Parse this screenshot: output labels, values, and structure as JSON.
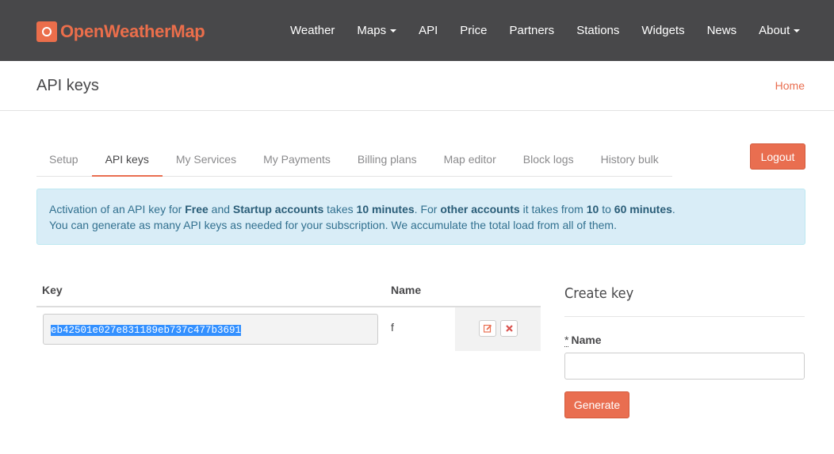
{
  "brand": {
    "name": "OpenWeatherMap",
    "accent": "#e96e50"
  },
  "nav": [
    {
      "label": "Weather",
      "dropdown": false
    },
    {
      "label": "Maps",
      "dropdown": true
    },
    {
      "label": "API",
      "dropdown": false
    },
    {
      "label": "Price",
      "dropdown": false
    },
    {
      "label": "Partners",
      "dropdown": false
    },
    {
      "label": "Stations",
      "dropdown": false
    },
    {
      "label": "Widgets",
      "dropdown": false
    },
    {
      "label": "News",
      "dropdown": false
    },
    {
      "label": "About",
      "dropdown": true
    }
  ],
  "page": {
    "title": "API keys",
    "breadcrumb_home": "Home"
  },
  "tabs": [
    {
      "label": "Setup",
      "active": false
    },
    {
      "label": "API keys",
      "active": true
    },
    {
      "label": "My Services",
      "active": false
    },
    {
      "label": "My Payments",
      "active": false
    },
    {
      "label": "Billing plans",
      "active": false
    },
    {
      "label": "Map editor",
      "active": false
    },
    {
      "label": "Block logs",
      "active": false
    },
    {
      "label": "History bulk",
      "active": false
    }
  ],
  "logout_label": "Logout",
  "alert": {
    "line1": [
      {
        "t": "Activation of an API key for ",
        "b": false
      },
      {
        "t": "Free",
        "b": true
      },
      {
        "t": " and ",
        "b": false
      },
      {
        "t": "Startup accounts",
        "b": true
      },
      {
        "t": " takes ",
        "b": false
      },
      {
        "t": "10 minutes",
        "b": true
      },
      {
        "t": ". For ",
        "b": false
      },
      {
        "t": "other accounts",
        "b": true
      },
      {
        "t": " it takes from ",
        "b": false
      },
      {
        "t": "10",
        "b": true
      },
      {
        "t": " to ",
        "b": false
      },
      {
        "t": "60 minutes",
        "b": true
      },
      {
        "t": ".",
        "b": false
      }
    ],
    "line2": "You can generate as many API keys as needed for your subscription. We accumulate the total load from all of them."
  },
  "keys_table": {
    "headers": {
      "key": "Key",
      "name": "Name"
    },
    "rows": [
      {
        "key": "eb42501e027e831189eb737c477b3691",
        "name": "f"
      }
    ]
  },
  "create_key": {
    "title": "Create key",
    "required_mark": "*",
    "name_label": "Name",
    "name_value": "",
    "generate_label": "Generate"
  }
}
